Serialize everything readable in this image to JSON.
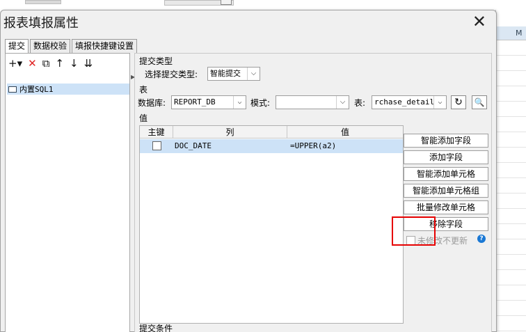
{
  "dialog": {
    "title": "报表填报属性",
    "close": "✕",
    "tabs": [
      "提交",
      "数据校验",
      "填报快捷键设置"
    ]
  },
  "left": {
    "tree_item": "内置SQL1"
  },
  "submit_type": {
    "section": "提交类型",
    "label": "选择提交类型:",
    "value": "智能提交"
  },
  "table_section": {
    "section": "表",
    "db_label": "数据库:",
    "db_value": "REPORT_DB",
    "schema_label": "模式:",
    "schema_value": "",
    "table_label": "表:",
    "table_value": "rchase_detail"
  },
  "values": {
    "section": "值",
    "headers": [
      "主键",
      "列",
      "值"
    ],
    "rows": [
      {
        "column": "DOC_DATE",
        "value": "=UPPER(a2)"
      }
    ]
  },
  "side_buttons": [
    "智能添加字段",
    "添加字段",
    "智能添加单元格",
    "智能添加单元格组",
    "批量修改单元格",
    "移除字段"
  ],
  "no_update": {
    "label": "未修改不更新"
  },
  "bottom_section": "提交条件"
}
